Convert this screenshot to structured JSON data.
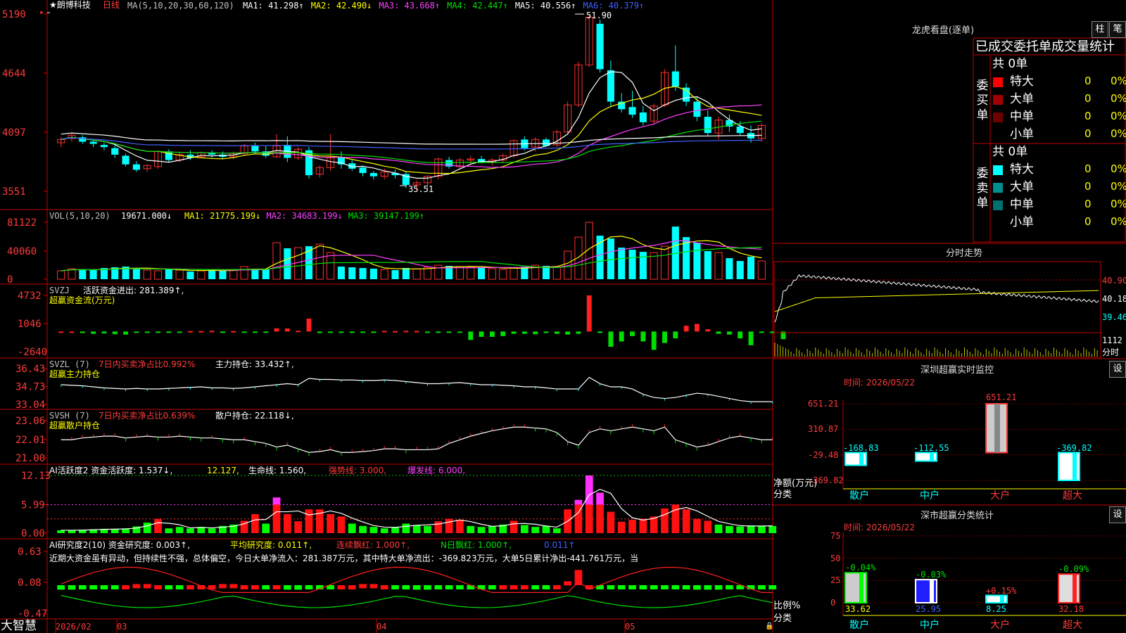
{
  "app": {
    "brand": "大智慧"
  },
  "main": {
    "stock_name": "★朗博科技",
    "period": "日线",
    "ma_header": "MA(5,10,20,30,60,120)",
    "ma": [
      {
        "label": "MA1: 41.298↑",
        "color": "#ffffff"
      },
      {
        "label": "MA2: 42.490↓",
        "color": "#ffff00"
      },
      {
        "label": "MA3: 43.668↑",
        "color": "#ff40ff"
      },
      {
        "label": "MA4: 42.447↑",
        "color": "#00e000"
      },
      {
        "label": "MA5: 40.556↑",
        "color": "#ffffff"
      },
      {
        "label": "MA6: 40.379↑",
        "color": "#4060ff"
      }
    ],
    "price_ticks": [
      "5190",
      "4644",
      "4097",
      "3551"
    ],
    "high_label": "51.90",
    "low_label": "35.51",
    "cursor_label": "5190"
  },
  "vol": {
    "header": "VOL(5,10,20)",
    "value": "19671.000↓",
    "ma": [
      {
        "label": "MA1: 21775.199↓",
        "color": "#ffff00"
      },
      {
        "label": "MA2: 34683.199↓",
        "color": "#ff40ff"
      },
      {
        "label": "MA3: 39147.199↑",
        "color": "#00e000"
      }
    ],
    "ticks": [
      "81122",
      "40060",
      "0"
    ]
  },
  "svzj": {
    "header": "SVZJ",
    "line1": "活跃资金进出: 281.389↑,",
    "line2": "超赢资金流(万元)",
    "ticks": [
      "4732",
      "1046",
      "-2640"
    ]
  },
  "svzl": {
    "header": "SVZL (7)",
    "red_text": "7日内买卖净占比0.992%",
    "value": "主力持仓: 33.432↑,",
    "line2": "超赢主力持仓",
    "ticks": [
      "36.43",
      "34.73",
      "33.04"
    ]
  },
  "svsh": {
    "header": "SVSH (7)",
    "red_text": "7日内买卖净占比0.639%",
    "value": "散户持仓: 22.118↓,",
    "line2": "超赢散户持仓",
    "ticks": [
      "23.06",
      "22.01",
      "21.00"
    ]
  },
  "ai1": {
    "header": "AI活跃度2 资金活跃度: 1.537↓,",
    "v2": "12.127,",
    "v3": "生命线: 1.560,",
    "v4": "强势线: 3.000,",
    "v5": "爆发线: 6.000,",
    "ticks": [
      "12.13",
      "5.99",
      "0.00"
    ]
  },
  "ai2": {
    "header": "AI研究度2(10) 资金研究度: 0.003↑,",
    "v2": "平均研究度: 0.011↑,",
    "v3": "连续飘红: 1.000↑,",
    "v4": "N日飘红: 1.000↑,",
    "v5": "0.011↑",
    "comment": "近期大资金虽有异动，但持续性不强，总体偏空，今日大单净流入：281.387万元，其中特大单净流出：-369.823万元，大单5日累计净出-441.761万元，当",
    "ticks": [
      "0.63",
      "0.08",
      "-0.47"
    ]
  },
  "time_axis": {
    "labels": [
      "2026/02",
      "03",
      "04",
      "05"
    ]
  },
  "lhb": {
    "title": "龙虎看盘(逐单)",
    "btn1": "柱",
    "btn2": "笔",
    "subtitle": "已成交委托单成交量统计",
    "buy_label": [
      "委",
      "买",
      "单"
    ],
    "sell_label": [
      "委",
      "卖",
      "单"
    ],
    "buy_total": "共 0单",
    "sell_total": "共 0单",
    "buy_rows": [
      {
        "name": "特大",
        "vol": "0",
        "pct": "0%",
        "color": "#ff0000"
      },
      {
        "name": "大单",
        "vol": "0",
        "pct": "0%",
        "color": "#a00000"
      },
      {
        "name": "中单",
        "vol": "0",
        "pct": "0%",
        "color": "#700000"
      },
      {
        "name": "小单",
        "vol": "0",
        "pct": "0%",
        "color": ""
      }
    ],
    "sell_rows": [
      {
        "name": "特大",
        "vol": "0",
        "pct": "0%",
        "color": "#00ffff"
      },
      {
        "name": "大单",
        "vol": "0",
        "pct": "0%",
        "color": "#009090"
      },
      {
        "name": "中单",
        "vol": "0",
        "pct": "0%",
        "color": "#007070"
      },
      {
        "name": "小单",
        "vol": "0",
        "pct": "0%",
        "color": ""
      }
    ]
  },
  "intraday": {
    "title": "分时走势",
    "ticks": [
      "40.90",
      "40.18",
      "39.46"
    ],
    "vol_tick": "1112",
    "vol_label": "分时"
  },
  "monitor": {
    "title": "深圳超赢实时监控",
    "btn": "设",
    "time": "时间: 2026/05/22",
    "ticks": [
      "651.21",
      "310.87",
      "-29.48",
      "-369.82"
    ],
    "axis_label1": "净额(万元)",
    "axis_label2": "分类",
    "categories": [
      "散户",
      "中户",
      "大户",
      "超大"
    ],
    "bar_labels": [
      "-168.83",
      "-112.55",
      "651.21",
      "-369.82"
    ]
  },
  "classify": {
    "title": "深市超赢分类统计",
    "btn": "设",
    "time": "时间: 2026/05/22",
    "ticks": [
      "75",
      "50",
      "25",
      "0"
    ],
    "axis_label1": "比例%",
    "axis_label2": "分类",
    "categories": [
      "散户",
      "中户",
      "大户",
      "超大"
    ],
    "pct_labels": [
      "-0.04%",
      "-0.03%",
      "+0.15%",
      "-0.09%"
    ],
    "values_text": [
      "33.62",
      "25.95",
      "8.25",
      "32.18"
    ]
  },
  "chart_data": [
    {
      "type": "candlestick",
      "ylim": [
        35.51,
        51.9
      ],
      "high": 51.9,
      "low": 35.51,
      "ohlc": [
        [
          40.0,
          40.5,
          39.6,
          40.3
        ],
        [
          40.4,
          40.9,
          40.1,
          40.7
        ],
        [
          40.5,
          40.7,
          39.9,
          40.1
        ],
        [
          40.1,
          40.3,
          39.6,
          39.9
        ],
        [
          39.8,
          40.0,
          39.3,
          39.6
        ],
        [
          39.5,
          39.8,
          38.6,
          38.9
        ],
        [
          38.8,
          39.0,
          37.8,
          38.0
        ],
        [
          38.0,
          38.3,
          37.3,
          37.5
        ],
        [
          37.6,
          38.0,
          37.3,
          37.9
        ],
        [
          37.8,
          39.3,
          37.6,
          39.2
        ],
        [
          39.2,
          39.4,
          38.2,
          38.4
        ],
        [
          38.4,
          39.2,
          38.2,
          38.9
        ],
        [
          38.9,
          39.3,
          38.4,
          38.6
        ],
        [
          38.7,
          39.2,
          38.6,
          39.1
        ],
        [
          39.1,
          39.3,
          38.6,
          38.9
        ],
        [
          38.9,
          39.2,
          38.5,
          38.7
        ],
        [
          38.7,
          39.2,
          38.5,
          39.0
        ],
        [
          39.0,
          39.9,
          38.8,
          39.7
        ],
        [
          39.7,
          40.0,
          39.0,
          39.2
        ],
        [
          39.2,
          39.7,
          38.6,
          38.8
        ],
        [
          38.7,
          40.8,
          38.6,
          39.7
        ],
        [
          39.8,
          40.6,
          38.2,
          38.6
        ],
        [
          38.6,
          39.6,
          38.4,
          39.4
        ],
        [
          39.3,
          39.6,
          36.7,
          37.0
        ],
        [
          37.1,
          37.9,
          36.8,
          37.7
        ],
        [
          37.7,
          40.8,
          37.4,
          38.6
        ],
        [
          38.7,
          39.2,
          37.6,
          38.0
        ],
        [
          38.1,
          38.4,
          37.4,
          37.6
        ],
        [
          37.7,
          37.9,
          36.9,
          37.2
        ],
        [
          37.2,
          37.4,
          36.6,
          36.9
        ],
        [
          36.9,
          37.6,
          36.6,
          37.3
        ],
        [
          37.2,
          37.5,
          36.7,
          37.0
        ],
        [
          37.1,
          37.3,
          35.8,
          36.1
        ],
        [
          36.1,
          36.5,
          35.51,
          36.3
        ],
        [
          36.3,
          37.0,
          35.8,
          36.9
        ],
        [
          36.9,
          38.6,
          36.6,
          38.5
        ],
        [
          38.4,
          38.7,
          37.6,
          37.8
        ],
        [
          37.8,
          38.6,
          37.6,
          38.4
        ],
        [
          38.4,
          38.8,
          38.0,
          38.5
        ],
        [
          38.5,
          38.8,
          38.1,
          38.2
        ],
        [
          38.2,
          38.6,
          37.9,
          38.4
        ],
        [
          38.4,
          39.0,
          38.1,
          38.8
        ],
        [
          38.8,
          40.3,
          38.6,
          40.2
        ],
        [
          40.3,
          40.6,
          39.3,
          39.5
        ],
        [
          39.6,
          40.5,
          39.2,
          40.3
        ],
        [
          40.3,
          40.5,
          39.6,
          39.7
        ],
        [
          39.8,
          41.2,
          39.6,
          41.0
        ],
        [
          41.0,
          43.8,
          40.8,
          43.5
        ],
        [
          43.5,
          47.5,
          43.3,
          47.2
        ],
        [
          47.2,
          51.9,
          47.0,
          51.6
        ],
        [
          51.0,
          51.4,
          46.5,
          46.8
        ],
        [
          46.7,
          47.6,
          43.3,
          43.8
        ],
        [
          43.8,
          44.6,
          42.8,
          43.1
        ],
        [
          43.3,
          44.8,
          42.3,
          42.6
        ],
        [
          42.8,
          43.4,
          41.6,
          41.9
        ],
        [
          42.0,
          43.6,
          41.7,
          43.4
        ],
        [
          43.5,
          46.8,
          43.3,
          46.5
        ],
        [
          46.6,
          49.0,
          44.8,
          45.2
        ],
        [
          45.1,
          45.5,
          43.4,
          43.8
        ],
        [
          43.8,
          44.3,
          42.0,
          42.4
        ],
        [
          42.4,
          43.0,
          40.6,
          40.9
        ],
        [
          40.9,
          42.4,
          40.3,
          42.1
        ],
        [
          42.1,
          42.6,
          41.0,
          41.5
        ],
        [
          41.5,
          42.0,
          40.7,
          40.9
        ],
        [
          40.9,
          41.6,
          40.0,
          40.4
        ],
        [
          40.4,
          41.8,
          40.1,
          41.6
        ]
      ]
    },
    {
      "type": "bar",
      "name": "VOL",
      "ylim": [
        0,
        81122
      ],
      "values": [
        12000,
        15000,
        14000,
        13000,
        16000,
        17000,
        18000,
        15000,
        13000,
        12000,
        14000,
        13000,
        11000,
        12000,
        13000,
        12000,
        14000,
        18000,
        15000,
        14000,
        52000,
        44000,
        45000,
        47000,
        50000,
        38000,
        18000,
        17000,
        16000,
        15000,
        14000,
        13000,
        16000,
        15000,
        17000,
        20000,
        19000,
        18000,
        17000,
        16000,
        15000,
        14000,
        16000,
        18000,
        20000,
        19000,
        17000,
        40000,
        60000,
        81122,
        62000,
        58000,
        45000,
        42000,
        39000,
        38000,
        47000,
        75000,
        60000,
        52000,
        40000,
        38000,
        30000,
        26000,
        32000,
        26000
      ]
    },
    {
      "type": "bar",
      "name": "SVZJ",
      "ylim": [
        -2640,
        4732
      ],
      "values": [
        0,
        0,
        -200,
        -300,
        -250,
        -350,
        -400,
        -150,
        -100,
        -80,
        -120,
        -100,
        60,
        60,
        90,
        -100,
        60,
        -80,
        -80,
        -50,
        420,
        400,
        100,
        1700,
        -200,
        -160,
        -100,
        -80,
        -160,
        -120,
        80,
        60,
        90,
        80,
        -100,
        -160,
        -60,
        -80,
        -1100,
        -700,
        -700,
        -600,
        -300,
        -300,
        -350,
        -200,
        -300,
        -400,
        -300,
        4732,
        -200,
        -2000,
        -1300,
        -600,
        -1300,
        -2400,
        -1500,
        -900,
        760,
        1000,
        300,
        -300,
        -400,
        -900,
        -1800,
        -100,
        -200,
        -1000
      ]
    },
    {
      "type": "line",
      "name": "SVZL",
      "ylim": [
        33.04,
        36.43
      ],
      "values": [
        34.9,
        34.85,
        34.8,
        34.7,
        34.6,
        34.55,
        34.5,
        34.55,
        34.5,
        34.5,
        34.55,
        34.6,
        34.65,
        34.7,
        34.6,
        34.6,
        34.55,
        34.6,
        34.7,
        34.8,
        34.9,
        35.0,
        34.9,
        35.5,
        35.4,
        35.4,
        35.35,
        35.35,
        35.3,
        35.3,
        35.35,
        35.3,
        35.2,
        35.1,
        35.0,
        35.0,
        35.05,
        35.1,
        35.0,
        34.9,
        34.9,
        34.85,
        34.8,
        34.7,
        34.7,
        34.6,
        34.5,
        34.5,
        34.5,
        35.6,
        35.0,
        34.7,
        34.7,
        34.5,
        34.0,
        33.7,
        33.6,
        33.7,
        33.9,
        34.1,
        34.0,
        33.8,
        33.6,
        33.4,
        33.3,
        33.3,
        33.3
      ]
    },
    {
      "type": "line",
      "name": "SVSH",
      "ylim": [
        21.0,
        23.06
      ],
      "values": [
        22.0,
        22.0,
        22.1,
        22.15,
        22.2,
        22.2,
        22.1,
        22.15,
        22.2,
        22.15,
        22.15,
        22.2,
        22.15,
        22.1,
        22.1,
        22.05,
        22.0,
        22.0,
        21.9,
        21.8,
        21.6,
        21.7,
        21.5,
        21.3,
        21.35,
        21.45,
        21.3,
        21.3,
        21.35,
        21.4,
        21.5,
        21.5,
        21.45,
        21.45,
        21.45,
        21.5,
        21.8,
        22.0,
        22.2,
        22.35,
        22.5,
        22.6,
        22.7,
        22.7,
        22.65,
        22.6,
        22.4,
        21.9,
        21.7,
        22.4,
        22.6,
        22.5,
        22.6,
        22.7,
        22.6,
        22.5,
        22.7,
        22.0,
        21.8,
        21.6,
        21.7,
        21.9,
        22.1,
        22.2,
        22.1,
        22.0,
        22.0
      ]
    },
    {
      "type": "bar",
      "name": "AI活跃度2",
      "ylim": [
        0,
        12.13
      ],
      "values": [
        0.6,
        0.6,
        0.7,
        0.8,
        0.9,
        0.8,
        1.0,
        1.4,
        2.2,
        3.0,
        1.0,
        1.3,
        1.0,
        1.3,
        1.0,
        1.5,
        1.8,
        2.6,
        4.0,
        2.0,
        7.5,
        4.0,
        2.5,
        5.0,
        5.0,
        4.0,
        3.5,
        2.0,
        1.5,
        1.3,
        1.0,
        1.3,
        2.0,
        1.7,
        1.5,
        2.5,
        3.0,
        2.8,
        1.5,
        1.3,
        1.5,
        1.8,
        2.6,
        1.7,
        1.3,
        1.5,
        1.0,
        5.0,
        7.0,
        12.127,
        8.5,
        4.5,
        2.4,
        2.8,
        3.0,
        3.5,
        5.2,
        6.0,
        5.0,
        3.0,
        2.6,
        1.8,
        1.5,
        1.4,
        1.6,
        1.5,
        1.5
      ]
    },
    {
      "type": "bar",
      "name": "AI研究度2",
      "ylim": [
        -0.47,
        0.63
      ],
      "values": [
        -0.05,
        -0.05,
        -0.04,
        -0.04,
        -0.03,
        -0.03,
        0.03,
        0.05,
        0.05,
        0.03,
        -0.04,
        -0.04,
        0.02,
        0.02,
        0.02,
        0.05,
        0.05,
        0.02,
        0.02,
        -0.03,
        0.03,
        -0.05,
        -0.05,
        -0.04,
        -0.03,
        -0.02,
        0.02,
        0.03,
        0.05,
        0.05,
        0.03,
        -0.03,
        -0.03,
        -0.05,
        -0.05,
        -0.04,
        -0.04,
        -0.03,
        -0.03,
        -0.04,
        -0.02,
        0.03,
        0.03,
        0.03,
        -0.04,
        -0.04,
        0.02,
        0.1,
        0.3,
        0.02,
        -0.04,
        -0.04,
        -0.04,
        -0.03,
        -0.03,
        -0.03,
        -0.04,
        -0.04,
        -0.04,
        -0.05,
        -0.05,
        -0.05,
        -0.04,
        -0.04,
        -0.03,
        -0.03,
        -0.03
      ]
    },
    {
      "type": "bar",
      "name": "深圳超赢实时监控",
      "categories": [
        "散户",
        "中户",
        "大户",
        "超大"
      ],
      "values": [
        -168.83,
        -112.55,
        651.21,
        -369.82
      ],
      "ylim": [
        -369.82,
        651.21
      ]
    },
    {
      "type": "bar",
      "name": "深市超赢分类统计",
      "categories": [
        "散户",
        "中户",
        "大户",
        "超大"
      ],
      "values": [
        33.62,
        25.95,
        8.25,
        32.18
      ],
      "ylim": [
        0,
        75
      ]
    }
  ]
}
